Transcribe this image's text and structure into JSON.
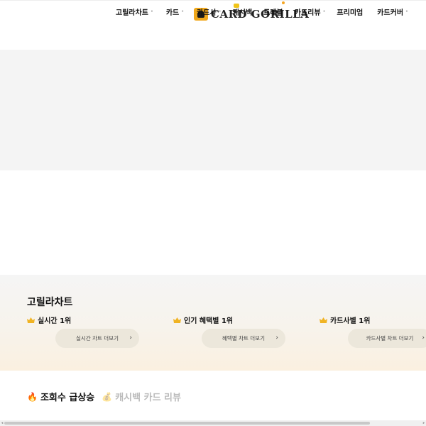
{
  "header": {
    "logo_text": "CARD GORILLA",
    "nav": [
      {
        "label": "고릴라차트",
        "has_dot": true
      },
      {
        "label": "카드",
        "has_dot": true
      },
      {
        "label": "카드사",
        "has_dot": true
      },
      {
        "label": "캐시백",
        "has_dot": false
      },
      {
        "label": "트래블",
        "has_dot": false
      },
      {
        "label": "카드리뷰",
        "has_dot": true
      },
      {
        "label": "프리미엄",
        "has_dot": false
      },
      {
        "label": "카드커버",
        "has_dot": true
      }
    ]
  },
  "chart_section": {
    "title": "고릴라차트",
    "cards": [
      {
        "heading": "실시간 1위",
        "button": "실시간 차트 더보기"
      },
      {
        "heading": "인기 혜택별 1위",
        "button": "혜택별 차트 더보기"
      },
      {
        "heading": "카드사별 1위",
        "button": "카드사별 차트 더보기"
      }
    ]
  },
  "trend": {
    "tabs": [
      {
        "label": "조회수 급상승",
        "icon": "fire-icon",
        "glyph": "🔥"
      },
      {
        "label": "캐시백 카드 리뷰",
        "icon": "money-bag-icon",
        "glyph": "💰"
      }
    ]
  },
  "colors": {
    "accent": "#f0a81c",
    "banner_bg": "#f4f4f4",
    "button_bg": "#ece7db"
  }
}
